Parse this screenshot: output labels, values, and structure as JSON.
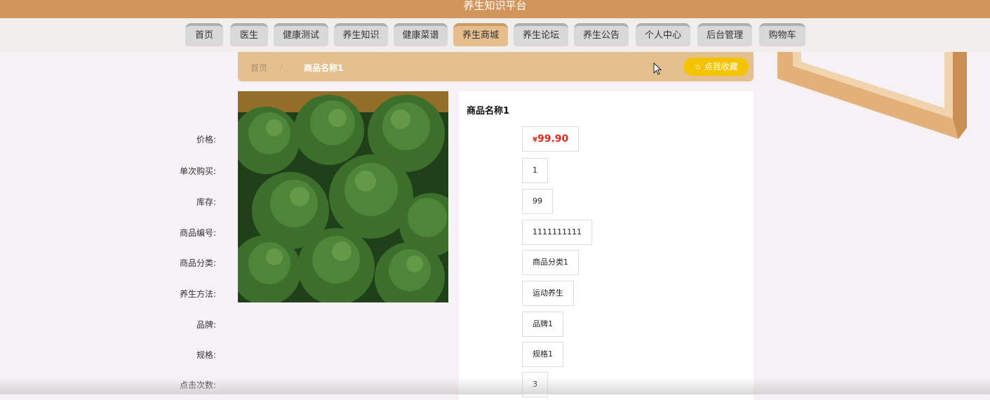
{
  "app": {
    "title": "养生知识平台"
  },
  "nav": {
    "items": [
      {
        "label": "首页"
      },
      {
        "label": "医生"
      },
      {
        "label": "健康测试"
      },
      {
        "label": "养生知识"
      },
      {
        "label": "健康菜谱"
      },
      {
        "label": "养生商城",
        "active": true
      },
      {
        "label": "养生论坛"
      },
      {
        "label": "养生公告"
      },
      {
        "label": "个人中心"
      },
      {
        "label": "后台管理"
      },
      {
        "label": "购物车"
      }
    ]
  },
  "breadcrumb": {
    "home": "首页",
    "separator": "/",
    "current": "商品名称1"
  },
  "favorite": {
    "label": "☆ 点我收藏"
  },
  "product": {
    "name": "商品名称1",
    "image": "broccoli-photo",
    "fields": [
      {
        "label": "价格:",
        "value": "99.90",
        "currency": "¥"
      },
      {
        "label": "单次购买:",
        "value": "1"
      },
      {
        "label": "库存:",
        "value": "99"
      },
      {
        "label": "商品编号:",
        "value": "1111111111"
      },
      {
        "label": "商品分类:",
        "value": "商品分类1"
      },
      {
        "label": "养生方法:",
        "value": "运动养生"
      },
      {
        "label": "品牌:",
        "value": "品牌1"
      },
      {
        "label": "规格:",
        "value": "规格1"
      },
      {
        "label": "点击次数:",
        "value": "3"
      }
    ]
  },
  "colors": {
    "header": "#d2965c",
    "nav_active": "#e6bd8c",
    "breadcrumb_bg": "#e4c08f",
    "favorite_button": "#f5c400",
    "price": "#e02a1c"
  }
}
